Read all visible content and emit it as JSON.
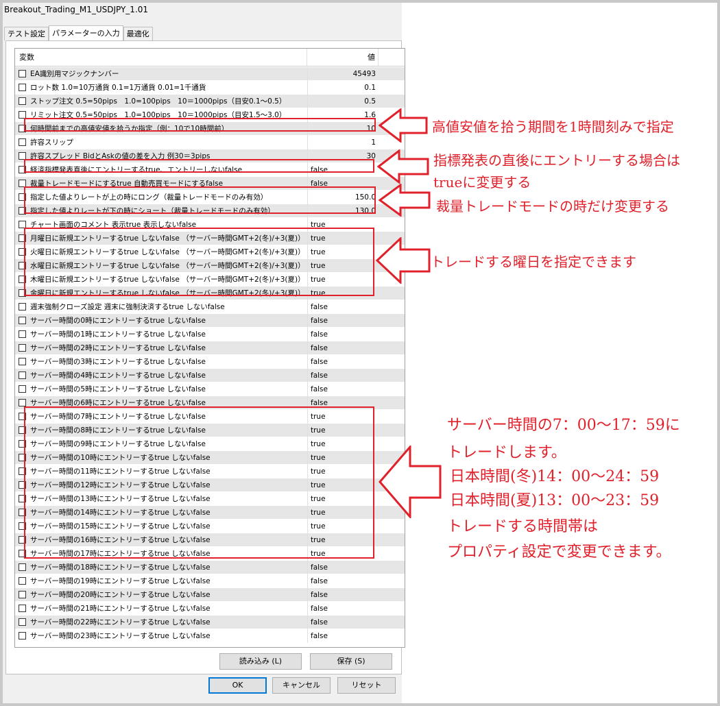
{
  "window": {
    "title": "Breakout_Trading_M1_USDJPY_1.01"
  },
  "tabs": [
    {
      "label": "テスト設定"
    },
    {
      "label": "パラメーターの入力"
    },
    {
      "label": "最適化"
    }
  ],
  "table": {
    "col_variable": "変数",
    "col_value": "値",
    "rows": [
      {
        "name": "EA識別用マジックナンバー",
        "value": "45493",
        "align": "right"
      },
      {
        "name": "ロット数 1.0=10万通貨 0.1=1万通貨 0.01=1千通貨",
        "value": "0.1",
        "align": "right"
      },
      {
        "name": "ストップ注文 0.5=50pips　1.0=100pips　10＝1000pips（目安0.1～0.5）",
        "value": "0.5",
        "align": "right"
      },
      {
        "name": "リミット注文 0.5=50pips　1.0=100pips　10＝1000pips（目安1.5～3.0）",
        "value": "1.6",
        "align": "right"
      },
      {
        "name": "何時間前までの高値安値を拾うか指定（例：10で10時間前）",
        "value": "10",
        "align": "right"
      },
      {
        "name": "許容スリップ",
        "value": "1",
        "align": "right"
      },
      {
        "name": "許容スプレッド BidとAskの値の差を入力 例30＝3pips",
        "value": "30",
        "align": "right"
      },
      {
        "name": "経済指標発表直後にエントリーするtrue、エントリーしないfalse",
        "value": "false",
        "align": "left"
      },
      {
        "name": "裁量トレードモードにするtrue 自動売買モードにするfalse",
        "value": "false",
        "align": "left"
      },
      {
        "name": "指定した値よりレートが上の時にロング（裁量トレードモードのみ有効）",
        "value": "150.0",
        "align": "right"
      },
      {
        "name": "指定した値よりレートが下の時にショート（裁量トレードモードのみ有効）",
        "value": "130.0",
        "align": "right"
      },
      {
        "name": "チャート画面のコメント 表示true 表示しないfalse",
        "value": "true",
        "align": "left"
      },
      {
        "name": "月曜日に新規エントリーするtrue しないfalse （サーバー時間GMT+2(冬)/+3(夏)）",
        "value": "true",
        "align": "left"
      },
      {
        "name": "火曜日に新規エントリーするtrue しないfalse （サーバー時間GMT+2(冬)/+3(夏)）",
        "value": "true",
        "align": "left"
      },
      {
        "name": "水曜日に新規エントリーするtrue しないfalse （サーバー時間GMT+2(冬)/+3(夏)）",
        "value": "true",
        "align": "left"
      },
      {
        "name": "木曜日に新規エントリーするtrue しないfalse （サーバー時間GMT+2(冬)/+3(夏)）",
        "value": "true",
        "align": "left"
      },
      {
        "name": "金曜日に新規エントリーするtrue しないfalse （サーバー時間GMT+2(冬)/+3(夏)）",
        "value": "true",
        "align": "left"
      },
      {
        "name": "週末強制クローズ設定 週末に強制決済するtrue しないfalse",
        "value": "false",
        "align": "left"
      },
      {
        "name": "サーバー時間の0時にエントリーするtrue しないfalse",
        "value": "false",
        "align": "left"
      },
      {
        "name": "サーバー時間の1時にエントリーするtrue しないfalse",
        "value": "false",
        "align": "left"
      },
      {
        "name": "サーバー時間の2時にエントリーするtrue しないfalse",
        "value": "false",
        "align": "left"
      },
      {
        "name": "サーバー時間の3時にエントリーするtrue しないfalse",
        "value": "false",
        "align": "left"
      },
      {
        "name": "サーバー時間の4時にエントリーするtrue しないfalse",
        "value": "false",
        "align": "left"
      },
      {
        "name": "サーバー時間の5時にエントリーするtrue しないfalse",
        "value": "false",
        "align": "left"
      },
      {
        "name": "サーバー時間の6時にエントリーするtrue しないfalse",
        "value": "false",
        "align": "left"
      },
      {
        "name": "サーバー時間の7時にエントリーするtrue しないfalse",
        "value": "true",
        "align": "left"
      },
      {
        "name": "サーバー時間の8時にエントリーするtrue しないfalse",
        "value": "true",
        "align": "left"
      },
      {
        "name": "サーバー時間の9時にエントリーするtrue しないfalse",
        "value": "true",
        "align": "left"
      },
      {
        "name": "サーバー時間の10時にエントリーするtrue しないfalse",
        "value": "true",
        "align": "left"
      },
      {
        "name": "サーバー時間の11時にエントリーするtrue しないfalse",
        "value": "true",
        "align": "left"
      },
      {
        "name": "サーバー時間の12時にエントリーするtrue しないfalse",
        "value": "true",
        "align": "left"
      },
      {
        "name": "サーバー時間の13時にエントリーするtrue しないfalse",
        "value": "true",
        "align": "left"
      },
      {
        "name": "サーバー時間の14時にエントリーするtrue しないfalse",
        "value": "true",
        "align": "left"
      },
      {
        "name": "サーバー時間の15時にエントリーするtrue しないfalse",
        "value": "true",
        "align": "left"
      },
      {
        "name": "サーバー時間の16時にエントリーするtrue しないfalse",
        "value": "true",
        "align": "left"
      },
      {
        "name": "サーバー時間の17時にエントリーするtrue しないfalse",
        "value": "true",
        "align": "left"
      },
      {
        "name": "サーバー時間の18時にエントリーするtrue しないfalse",
        "value": "false",
        "align": "left"
      },
      {
        "name": "サーバー時間の19時にエントリーするtrue しないfalse",
        "value": "false",
        "align": "left"
      },
      {
        "name": "サーバー時間の20時にエントリーするtrue しないfalse",
        "value": "false",
        "align": "left"
      },
      {
        "name": "サーバー時間の21時にエントリーするtrue しないfalse",
        "value": "false",
        "align": "left"
      },
      {
        "name": "サーバー時間の22時にエントリーするtrue しないfalse",
        "value": "false",
        "align": "left"
      },
      {
        "name": "サーバー時間の23時にエントリーするtrue しないfalse",
        "value": "false",
        "align": "left"
      }
    ]
  },
  "buttons": {
    "load": "読み込み (L)",
    "save": "保存 (S)",
    "ok": "OK",
    "cancel": "キャンセル",
    "reset": "リセット"
  },
  "annotations": {
    "lookback": "高値安値を拾う期間を1時間刻みで指定",
    "news_line1": "指標発表の直後にエントリーする場合は",
    "news_line2": "trueに変更する",
    "discretion": "裁量トレードモードの時だけ変更する",
    "weekdays": "トレードする曜日を指定できます",
    "hours_line1": "サーバー時間の7：00～17：59に",
    "hours_line2": "トレードします。",
    "hours_line3": "日本時間(冬)14：00～24：59",
    "hours_line4": "日本時間(夏)13：00～23：59",
    "hours_line5": "トレードする時間帯は",
    "hours_line6": "プロパティ設定で変更できます。"
  },
  "colors": {
    "annotation_red": "#e0202a",
    "row_alt": "#e6e6e6"
  }
}
